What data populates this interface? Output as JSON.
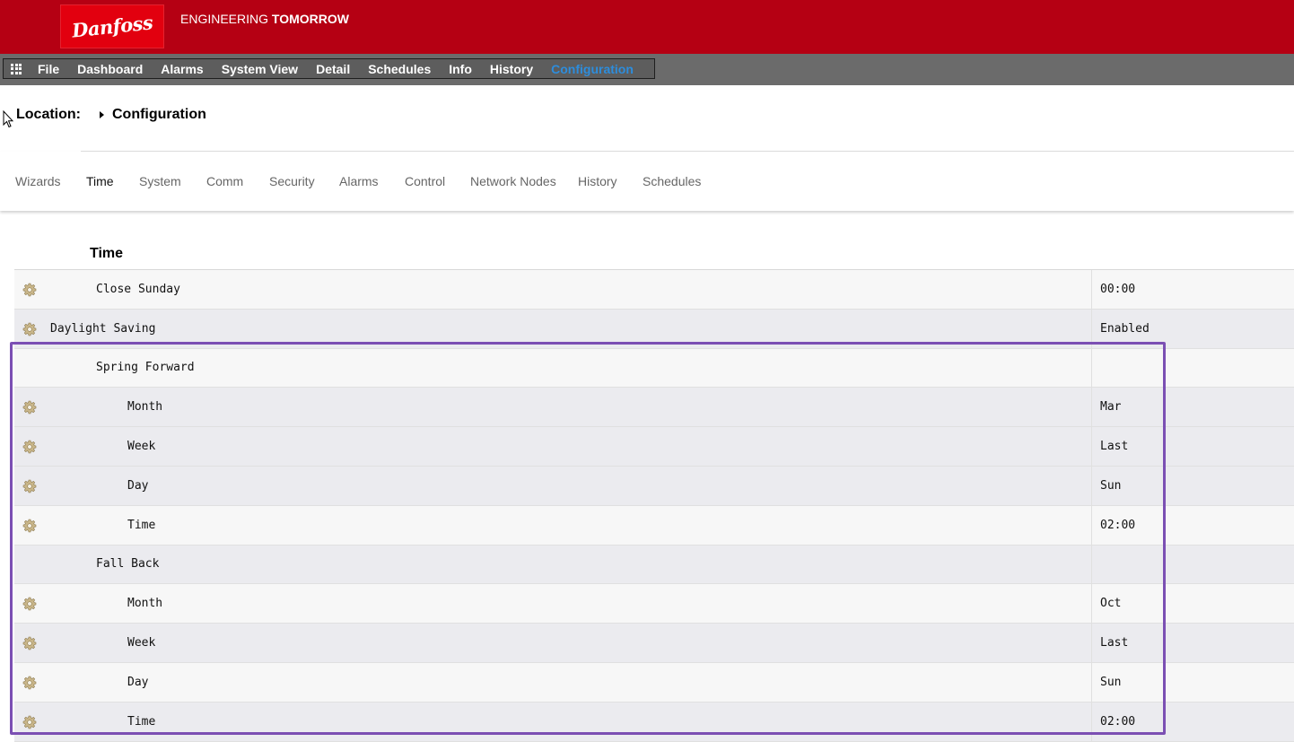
{
  "header": {
    "brand": "Danfoss",
    "tagline_prefix": "ENGINEERING ",
    "tagline_bold": "TOMORROW",
    "brand_color": "#b50013"
  },
  "menu": {
    "apps_icon": "apps-grid-icon",
    "items": [
      "File",
      "Dashboard",
      "Alarms",
      "System View",
      "Detail",
      "Schedules",
      "Info",
      "History",
      "Configuration"
    ],
    "active": "Configuration",
    "active_color": "#2d8ddc"
  },
  "location": {
    "label": "Location:",
    "crumb": "Configuration"
  },
  "tabs": {
    "items": [
      "Wizards",
      "Time",
      "System",
      "Comm",
      "Security",
      "Alarms",
      "Control",
      "Network Nodes",
      "History",
      "Schedules"
    ],
    "active": "Time"
  },
  "section": {
    "title": "Time"
  },
  "table": {
    "rows": [
      {
        "label": "Close Sunday",
        "value": "00:00",
        "gear": true
      },
      {
        "label": "Daylight Saving",
        "value": "Enabled",
        "gear": true
      },
      {
        "label": "Spring Forward",
        "value": "",
        "gear": false
      },
      {
        "label": "Month",
        "value": "Mar",
        "gear": true
      },
      {
        "label": "Week",
        "value": "Last",
        "gear": true
      },
      {
        "label": "Day",
        "value": "Sun",
        "gear": true
      },
      {
        "label": "Time",
        "value": "02:00",
        "gear": true
      },
      {
        "label": "Fall Back",
        "value": "",
        "gear": false
      },
      {
        "label": "Month",
        "value": "Oct",
        "gear": true
      },
      {
        "label": "Week",
        "value": "Last",
        "gear": true
      },
      {
        "label": "Day",
        "value": "Sun",
        "gear": true
      },
      {
        "label": "Time",
        "value": "02:00",
        "gear": true
      }
    ],
    "highlight_color": "#7b4fb3"
  }
}
